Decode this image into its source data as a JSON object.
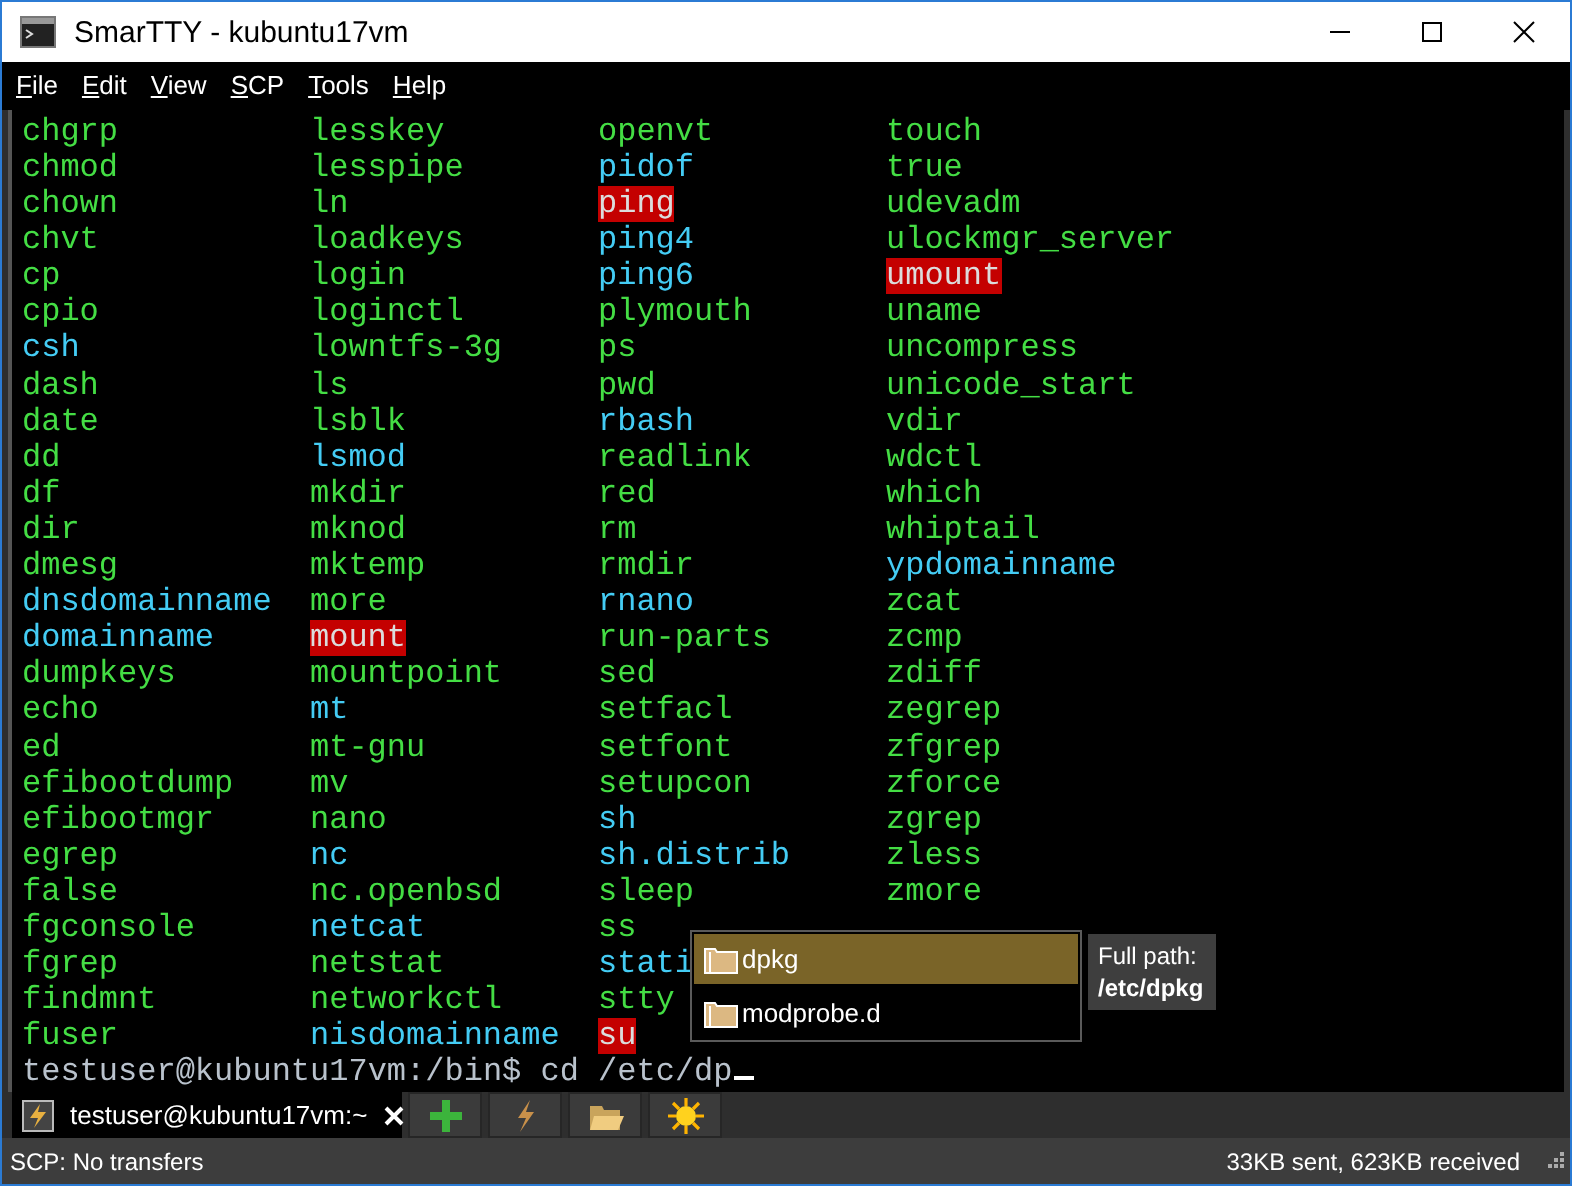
{
  "window": {
    "title": "SmarTTY - kubuntu17vm"
  },
  "menu": [
    {
      "label": "File"
    },
    {
      "label": "Edit"
    },
    {
      "label": "View"
    },
    {
      "label": "SCP"
    },
    {
      "label": "Tools"
    },
    {
      "label": "Help"
    }
  ],
  "terminal": {
    "listing": [
      [
        {
          "name": "chgrp",
          "kind": "exec"
        },
        {
          "name": "lesskey",
          "kind": "exec"
        },
        {
          "name": "openvt",
          "kind": "exec"
        },
        {
          "name": "touch",
          "kind": "exec"
        }
      ],
      [
        {
          "name": "chmod",
          "kind": "exec"
        },
        {
          "name": "lesspipe",
          "kind": "exec"
        },
        {
          "name": "pidof",
          "kind": "link"
        },
        {
          "name": "true",
          "kind": "exec"
        }
      ],
      [
        {
          "name": "chown",
          "kind": "exec"
        },
        {
          "name": "ln",
          "kind": "exec"
        },
        {
          "name": "ping",
          "kind": "setuid"
        },
        {
          "name": "udevadm",
          "kind": "exec"
        }
      ],
      [
        {
          "name": "chvt",
          "kind": "exec"
        },
        {
          "name": "loadkeys",
          "kind": "exec"
        },
        {
          "name": "ping4",
          "kind": "link"
        },
        {
          "name": "ulockmgr_server",
          "kind": "exec"
        }
      ],
      [
        {
          "name": "cp",
          "kind": "exec"
        },
        {
          "name": "login",
          "kind": "exec"
        },
        {
          "name": "ping6",
          "kind": "link"
        },
        {
          "name": "umount",
          "kind": "setuid"
        }
      ],
      [
        {
          "name": "cpio",
          "kind": "exec"
        },
        {
          "name": "loginctl",
          "kind": "exec"
        },
        {
          "name": "plymouth",
          "kind": "exec"
        },
        {
          "name": "uname",
          "kind": "exec"
        }
      ],
      [
        {
          "name": "csh",
          "kind": "link"
        },
        {
          "name": "lowntfs-3g",
          "kind": "exec"
        },
        {
          "name": "ps",
          "kind": "exec"
        },
        {
          "name": "uncompress",
          "kind": "exec"
        }
      ],
      [
        {
          "name": "dash",
          "kind": "exec"
        },
        {
          "name": "ls",
          "kind": "exec"
        },
        {
          "name": "pwd",
          "kind": "exec"
        },
        {
          "name": "unicode_start",
          "kind": "exec"
        }
      ],
      [
        {
          "name": "date",
          "kind": "exec"
        },
        {
          "name": "lsblk",
          "kind": "exec"
        },
        {
          "name": "rbash",
          "kind": "link"
        },
        {
          "name": "vdir",
          "kind": "exec"
        }
      ],
      [
        {
          "name": "dd",
          "kind": "exec"
        },
        {
          "name": "lsmod",
          "kind": "link"
        },
        {
          "name": "readlink",
          "kind": "exec"
        },
        {
          "name": "wdctl",
          "kind": "exec"
        }
      ],
      [
        {
          "name": "df",
          "kind": "exec"
        },
        {
          "name": "mkdir",
          "kind": "exec"
        },
        {
          "name": "red",
          "kind": "exec"
        },
        {
          "name": "which",
          "kind": "exec"
        }
      ],
      [
        {
          "name": "dir",
          "kind": "exec"
        },
        {
          "name": "mknod",
          "kind": "exec"
        },
        {
          "name": "rm",
          "kind": "exec"
        },
        {
          "name": "whiptail",
          "kind": "exec"
        }
      ],
      [
        {
          "name": "dmesg",
          "kind": "exec"
        },
        {
          "name": "mktemp",
          "kind": "exec"
        },
        {
          "name": "rmdir",
          "kind": "exec"
        },
        {
          "name": "ypdomainname",
          "kind": "link"
        }
      ],
      [
        {
          "name": "dnsdomainname",
          "kind": "link"
        },
        {
          "name": "more",
          "kind": "exec"
        },
        {
          "name": "rnano",
          "kind": "link"
        },
        {
          "name": "zcat",
          "kind": "exec"
        }
      ],
      [
        {
          "name": "domainname",
          "kind": "link"
        },
        {
          "name": "mount",
          "kind": "setuid"
        },
        {
          "name": "run-parts",
          "kind": "exec"
        },
        {
          "name": "zcmp",
          "kind": "exec"
        }
      ],
      [
        {
          "name": "dumpkeys",
          "kind": "exec"
        },
        {
          "name": "mountpoint",
          "kind": "exec"
        },
        {
          "name": "sed",
          "kind": "exec"
        },
        {
          "name": "zdiff",
          "kind": "exec"
        }
      ],
      [
        {
          "name": "echo",
          "kind": "exec"
        },
        {
          "name": "mt",
          "kind": "link"
        },
        {
          "name": "setfacl",
          "kind": "exec"
        },
        {
          "name": "zegrep",
          "kind": "exec"
        }
      ],
      [
        {
          "name": "ed",
          "kind": "exec"
        },
        {
          "name": "mt-gnu",
          "kind": "exec"
        },
        {
          "name": "setfont",
          "kind": "exec"
        },
        {
          "name": "zfgrep",
          "kind": "exec"
        }
      ],
      [
        {
          "name": "efibootdump",
          "kind": "exec"
        },
        {
          "name": "mv",
          "kind": "exec"
        },
        {
          "name": "setupcon",
          "kind": "exec"
        },
        {
          "name": "zforce",
          "kind": "exec"
        }
      ],
      [
        {
          "name": "efibootmgr",
          "kind": "exec"
        },
        {
          "name": "nano",
          "kind": "exec"
        },
        {
          "name": "sh",
          "kind": "link"
        },
        {
          "name": "zgrep",
          "kind": "exec"
        }
      ],
      [
        {
          "name": "egrep",
          "kind": "exec"
        },
        {
          "name": "nc",
          "kind": "link"
        },
        {
          "name": "sh.distrib",
          "kind": "link"
        },
        {
          "name": "zless",
          "kind": "exec"
        }
      ],
      [
        {
          "name": "false",
          "kind": "exec"
        },
        {
          "name": "nc.openbsd",
          "kind": "exec"
        },
        {
          "name": "sleep",
          "kind": "exec"
        },
        {
          "name": "zmore",
          "kind": "exec"
        }
      ],
      [
        {
          "name": "fgconsole",
          "kind": "exec"
        },
        {
          "name": "netcat",
          "kind": "link"
        },
        {
          "name": "ss",
          "kind": "exec"
        }
      ],
      [
        {
          "name": "fgrep",
          "kind": "exec"
        },
        {
          "name": "netstat",
          "kind": "exec"
        },
        {
          "name": "stati",
          "kind": "link"
        }
      ],
      [
        {
          "name": "findmnt",
          "kind": "exec"
        },
        {
          "name": "networkctl",
          "kind": "exec"
        },
        {
          "name": "stty",
          "kind": "exec"
        }
      ],
      [
        {
          "name": "fuser",
          "kind": "exec"
        },
        {
          "name": "nisdomainname",
          "kind": "link"
        },
        {
          "name": "su",
          "kind": "setuid"
        }
      ]
    ],
    "prompt": "testuser@kubuntu17vm:/bin$ cd /etc/dp",
    "completion": {
      "items": [
        {
          "label": "dpkg",
          "selected": true
        },
        {
          "label": "modprobe.d",
          "selected": false
        }
      ],
      "tooltip": {
        "label": "Full path:",
        "value": "/etc/dpkg"
      }
    }
  },
  "tabs": [
    {
      "label": "testuser@kubuntu17vm:~",
      "selected": true
    }
  ],
  "status_bar": {
    "left": "SCP: No transfers",
    "right": "33KB sent, 623KB received"
  }
}
